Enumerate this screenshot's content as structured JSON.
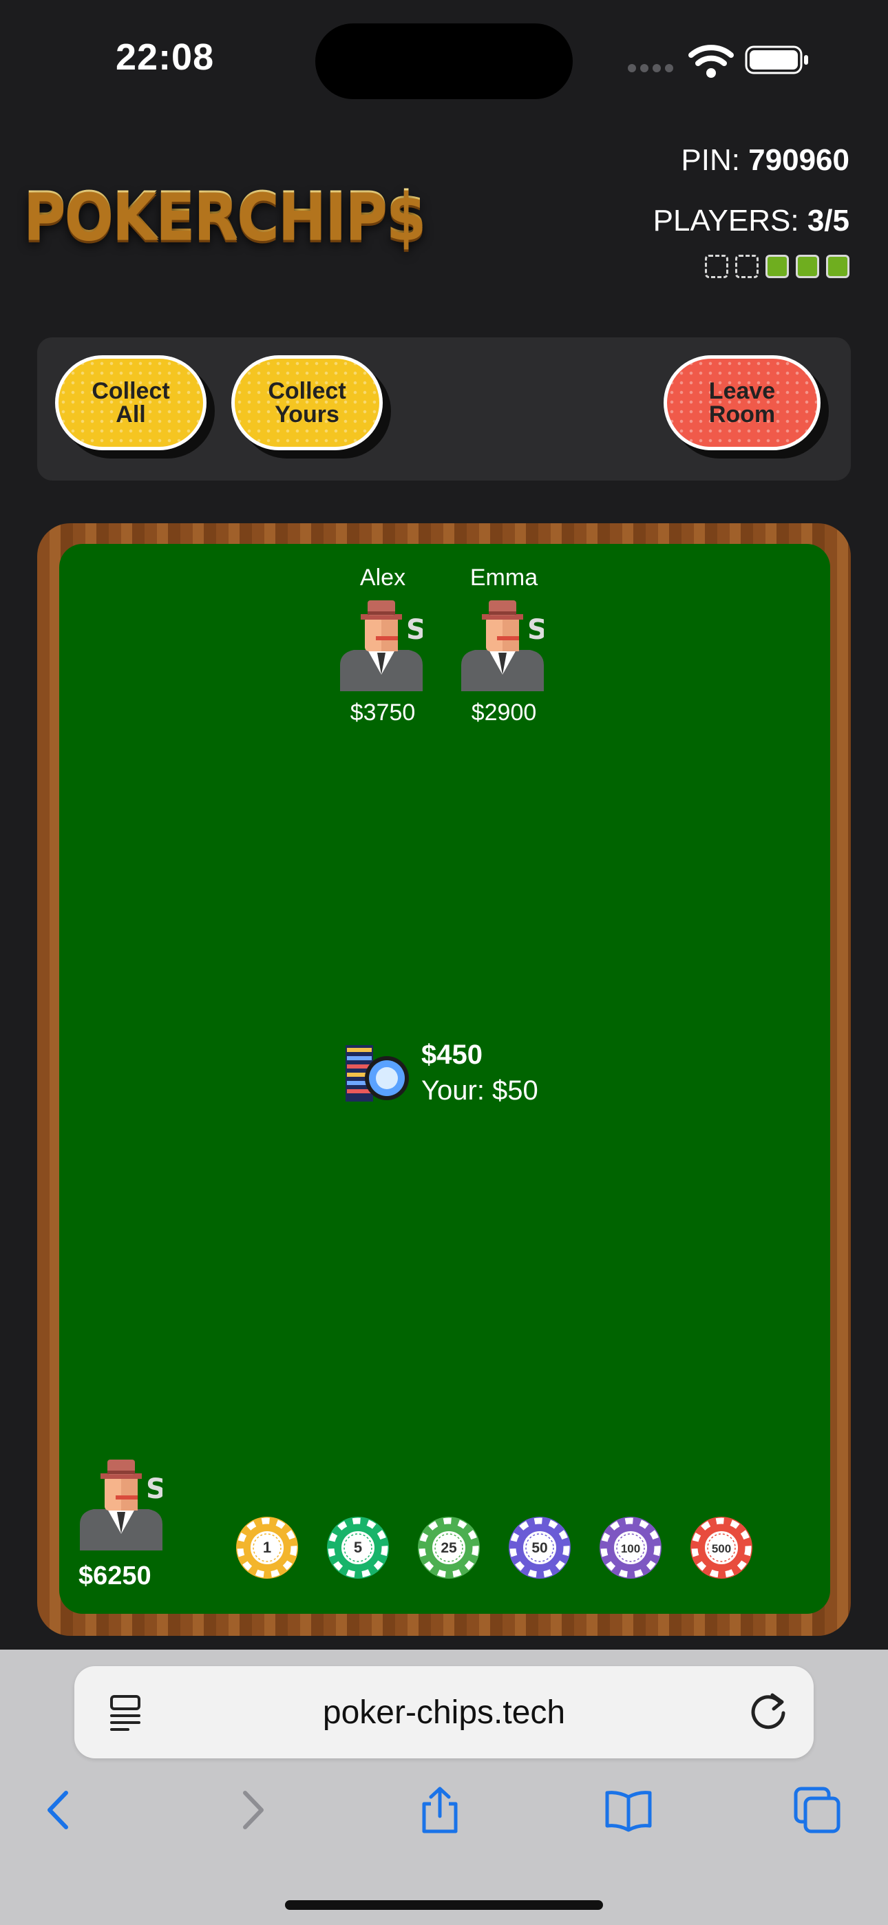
{
  "status_bar": {
    "time": "22:08"
  },
  "header": {
    "logo_text": "POKERCHIP$",
    "pin_label": "PIN: ",
    "pin_value": "790960",
    "players_label": "PLAYERS: ",
    "players_value": "3/5",
    "players_filled": 3,
    "players_total": 5
  },
  "actions": {
    "collect_all": "Collect All",
    "collect_yours": "Collect Yours",
    "leave_room": "Leave Room"
  },
  "table": {
    "opponents": [
      {
        "name": "Alex",
        "money": "$3750"
      },
      {
        "name": "Emma",
        "money": "$2900"
      }
    ],
    "pot": {
      "total": "$450",
      "yours": "Your: $50"
    },
    "me": {
      "money": "$6250"
    },
    "chips": [
      {
        "value": "1",
        "color": "#f3b52c"
      },
      {
        "value": "5",
        "color": "#18b46a"
      },
      {
        "value": "25",
        "color": "#4caf50"
      },
      {
        "value": "50",
        "color": "#6a5bd6"
      },
      {
        "value": "100",
        "color": "#7e57c2"
      },
      {
        "value": "500",
        "color": "#e84c3d"
      }
    ]
  },
  "browser": {
    "url": "poker-chips.tech"
  },
  "colors": {
    "felt": "#006400",
    "accent_yellow": "#f5c521",
    "accent_red": "#f05a4a",
    "progress_green": "#6fae1f"
  }
}
